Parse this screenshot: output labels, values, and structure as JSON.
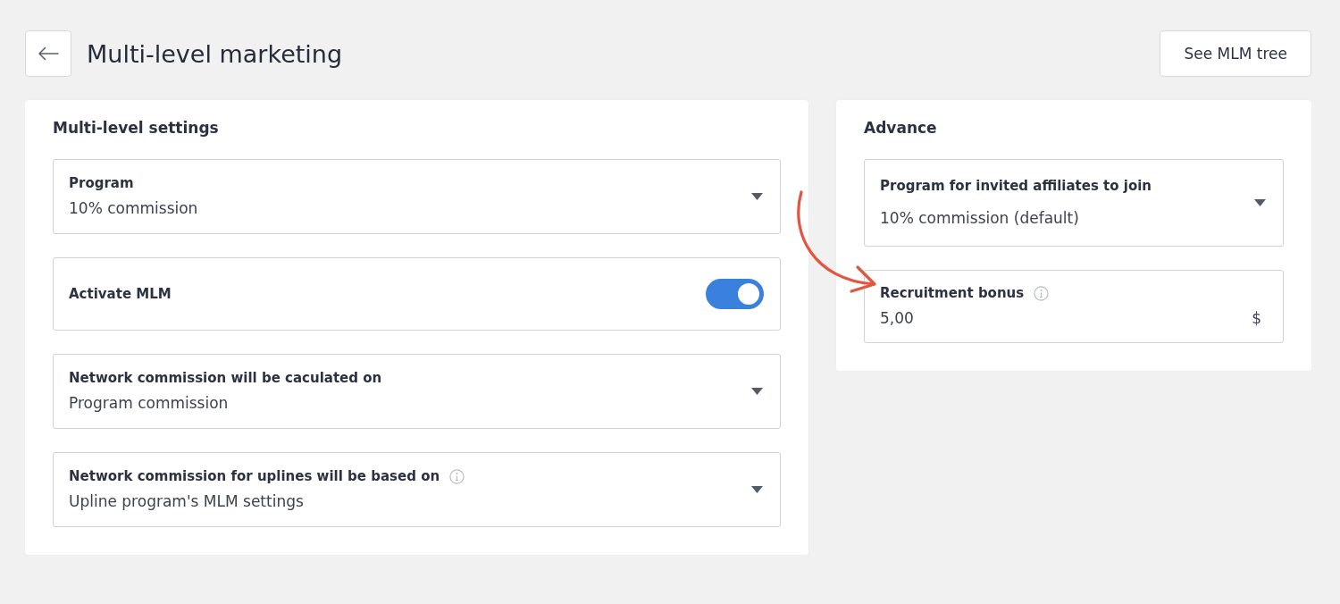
{
  "header": {
    "title": "Multi-level marketing",
    "button": "See MLM tree"
  },
  "cards": [
    {
      "title": "Multi-level settings",
      "fields": [
        {
          "kind": "select",
          "label": "Program",
          "value": "10% commission"
        },
        {
          "kind": "toggle",
          "label": "Activate MLM",
          "on": true
        },
        {
          "kind": "select",
          "label": "Network commission will be caculated on",
          "value": "Program commission"
        },
        {
          "kind": "select",
          "label": "Network commission for uplines will be based on",
          "info": true,
          "value": "Upline program's MLM settings"
        }
      ]
    },
    {
      "title": "Advance",
      "fields": [
        {
          "kind": "select",
          "label": "Program for invited affiliates to join",
          "value": "10% commission (default)"
        },
        {
          "kind": "input",
          "label": "Recruitment bonus",
          "info": true,
          "value": "5,00",
          "suffix": "$"
        }
      ]
    }
  ]
}
